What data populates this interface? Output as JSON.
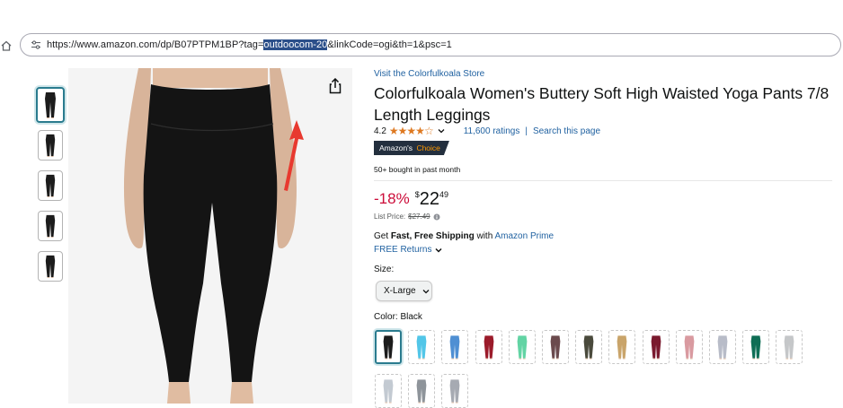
{
  "browser": {
    "url_before": "https://www.amazon.com/dp/B07PTPM1BP?tag=",
    "url_highlight": "outdoocom-20",
    "url_after": "&linkCode=ogi&th=1&psc=1"
  },
  "product": {
    "store_link": "Visit the Colorfulkoala Store",
    "title": "Colorfulkoala Women's Buttery Soft High Waisted Yoga Pants 7/8 Length Leggings",
    "rating": "4.2",
    "stars": "★★★★☆",
    "ratings_count": "11,600 ratings",
    "separator": "|",
    "search_page": "Search this page",
    "badge_a": "Amazon's",
    "badge_b": "Choice",
    "bought": "50+ bought in past month",
    "discount": "-18%",
    "currency": "$",
    "price_whole": "22",
    "price_fraction": "49",
    "list_price_label": "List Price:",
    "list_price": "$27.49",
    "ship_a": "Get ",
    "ship_b": "Fast, Free Shipping",
    "ship_c": " with ",
    "ship_prime": "Amazon Prime",
    "returns": "FREE Returns",
    "size_label": "Size:",
    "size_value": "X-Large",
    "color_label": "Color: ",
    "color_value": "Black"
  },
  "colors": {
    "accent": "#2a7b8e",
    "link": "#2162a1",
    "discount": "#cc0c39",
    "star": "#de7921",
    "badge_bg": "#232f3e",
    "badge_orange": "#ff9900",
    "annotation_arrow": "#e8392f"
  },
  "swatch_colors": [
    "#1c1c1c",
    "#52c6e8",
    "#4f8fd3",
    "#9b1b2a",
    "#62d4a4",
    "#6b4a4d",
    "#4a4a3c",
    "#c9a46a",
    "#7a1a2e",
    "#d99aa0",
    "#b8bcc8",
    "#0f6e55",
    "#c5c7c9",
    "#c3cad2",
    "#8e949a",
    "#a6aab2"
  ],
  "thumbnail_colors": [
    "#1c1c1c",
    "#1c1c1c",
    "#1c1c1c",
    "#1c1c1c",
    "#1c1c1c"
  ],
  "icons": [
    "home-icon",
    "tune-icon",
    "share-icon",
    "chevron-down-icon",
    "info-icon"
  ]
}
